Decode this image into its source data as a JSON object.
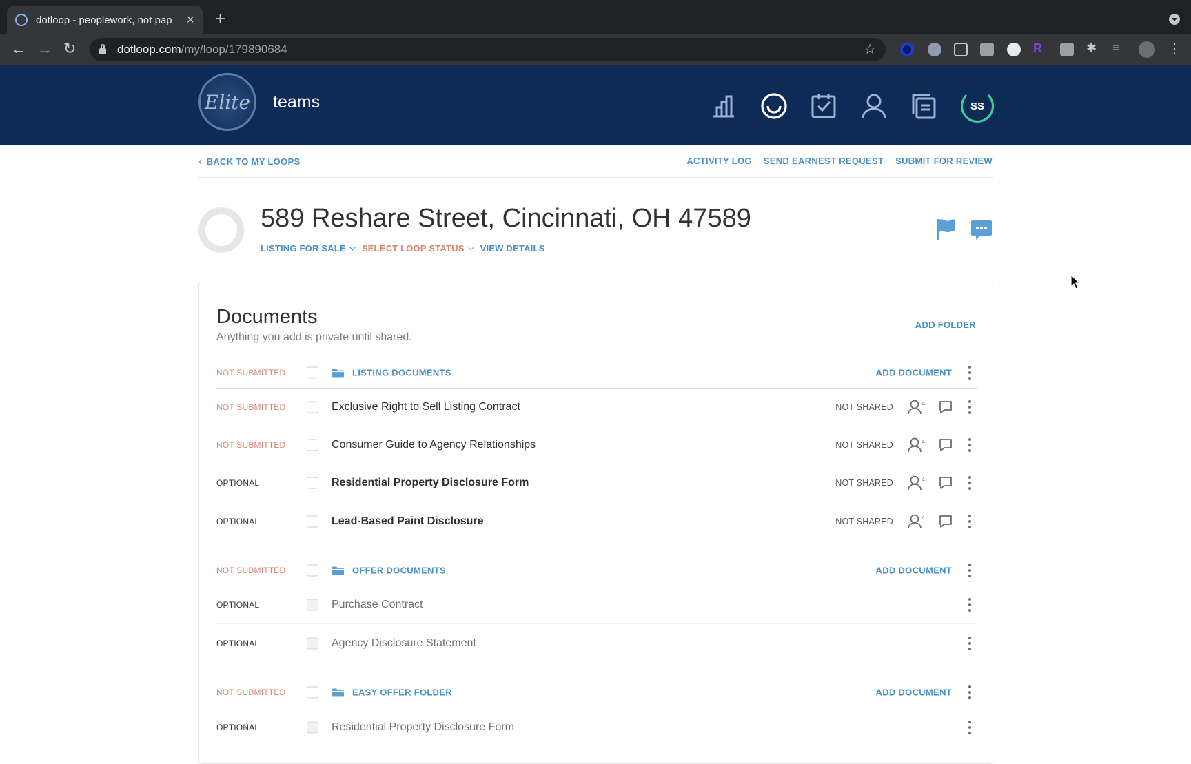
{
  "browser": {
    "tab_title": "dotloop - peoplework, not pap",
    "url_host": "dotloop.com",
    "url_path": "/my/loop/179890684"
  },
  "header": {
    "logo_text": "Elite",
    "brand_label": "teams",
    "avatar_initials": "SS",
    "colors": {
      "background": "#0e2a57",
      "avatar_ring": "#3fcf9b"
    }
  },
  "subnav": {
    "back": "BACK TO MY LOOPS",
    "activity_log": "ACTIVITY LOG",
    "send_earnest": "SEND EARNEST REQUEST",
    "submit_review": "SUBMIT FOR REVIEW"
  },
  "loop": {
    "title": "589 Reshare Street, Cincinnati, OH 47589",
    "type": "LISTING FOR SALE",
    "status": "SELECT LOOP STATUS",
    "view_details": "VIEW DETAILS"
  },
  "documents": {
    "title": "Documents",
    "subtitle": "Anything you add is private until shared.",
    "add_folder": "ADD FOLDER",
    "add_document": "ADD DOCUMENT",
    "folders": [
      {
        "status": "NOT SUBMITTED",
        "name": "LISTING DOCUMENTS",
        "docs": [
          {
            "status": "NOT SUBMITTED",
            "name": "Exclusive Right to Sell Listing Contract",
            "shared": "NOT SHARED",
            "participants": "4"
          },
          {
            "status": "NOT SUBMITTED",
            "name": "Consumer Guide to Agency Relationships",
            "shared": "NOT SHARED",
            "participants": "4"
          },
          {
            "status": "OPTIONAL",
            "name": "Residential Property Disclosure Form",
            "shared": "NOT SHARED",
            "participants": "4"
          },
          {
            "status": "OPTIONAL",
            "name": "Lead-Based Paint Disclosure",
            "shared": "NOT SHARED",
            "participants": "4"
          }
        ]
      },
      {
        "status": "NOT SUBMITTED",
        "name": "OFFER DOCUMENTS",
        "docs": [
          {
            "status": "OPTIONAL",
            "name": "Purchase Contract"
          },
          {
            "status": "OPTIONAL",
            "name": "Agency Disclosure Statement"
          }
        ]
      },
      {
        "status": "NOT SUBMITTED",
        "name": "EASY OFFER FOLDER",
        "docs": [
          {
            "status": "OPTIONAL",
            "name": "Residential Property Disclosure Form"
          }
        ]
      }
    ]
  },
  "colors": {
    "link": "#4a90c8",
    "not_submitted": "#d9866c",
    "loop_status": "#d9866c"
  }
}
